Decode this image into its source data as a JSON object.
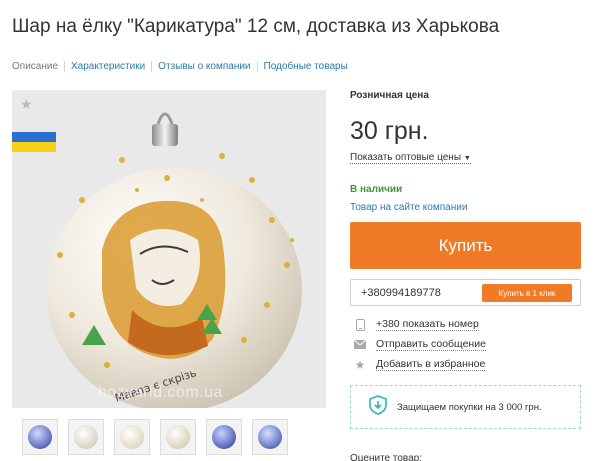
{
  "product": {
    "title": "Шар на ёлку \"Карикатура\" 12 см, доставка из Харькова"
  },
  "tabs": [
    {
      "label": "Описание"
    },
    {
      "label": "Характеристики"
    },
    {
      "label": "Отзывы о компании"
    },
    {
      "label": "Подобные товары"
    }
  ],
  "gallery": {
    "watermark": "hozyarid.com.ua",
    "thumbnail_count": 6
  },
  "pricing": {
    "label": "Розничная цена",
    "price": "30 грн.",
    "wholesale_link": "Показать оптовые цены",
    "availability": "В наличии",
    "company_site_link": "Товар на сайте компании"
  },
  "buy": {
    "button_label": "Купить",
    "phone": "+380994189778",
    "one_click_label": "Купить в 1 клик"
  },
  "actions": [
    {
      "icon": "phone-icon",
      "label": "+380 показать номер"
    },
    {
      "icon": "envelope-icon",
      "label": "Отправить сообщение"
    },
    {
      "icon": "star-icon",
      "label": "Добавить в избранное"
    }
  ],
  "protection": {
    "text": "Защищаем покупки на 3 000 грн."
  },
  "rating": {
    "label": "Оцените товар:"
  },
  "colors": {
    "accent_orange": "#f07a26",
    "link_blue": "#2a7ab0",
    "stock_green": "#3c9a2e"
  }
}
